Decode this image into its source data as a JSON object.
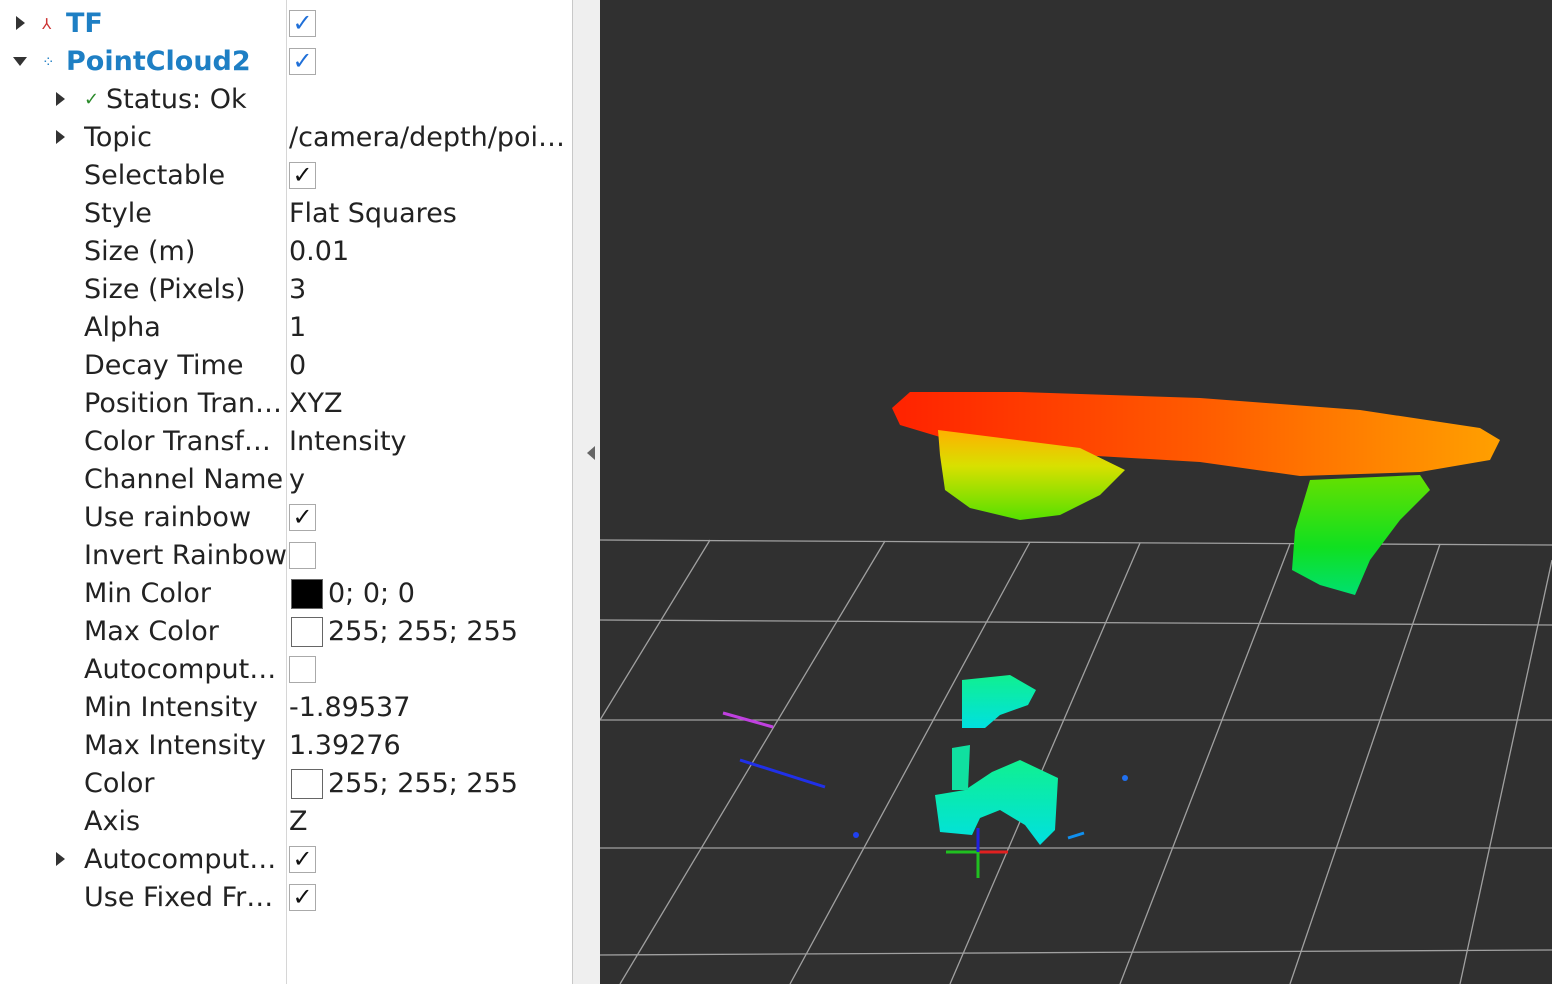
{
  "tree": {
    "tf": {
      "label": "TF",
      "checked": "✓",
      "icon": "tf-axes-icon"
    },
    "pointcloud": {
      "label": "PointCloud2",
      "checked": "✓",
      "icon": "pointcloud-icon"
    },
    "props": {
      "status_label": "Status: Ok",
      "status_icon": "check-icon",
      "status_check_glyph": "✓",
      "topic_label": "Topic",
      "topic_value": "/camera/depth/poi…",
      "selectable_label": "Selectable",
      "selectable_check": "✓",
      "style_label": "Style",
      "style_value": "Flat Squares",
      "size_m_label": "Size (m)",
      "size_m_value": "0.01",
      "size_px_label": "Size (Pixels)",
      "size_px_value": "3",
      "alpha_label": "Alpha",
      "alpha_value": "1",
      "decay_label": "Decay Time",
      "decay_value": "0",
      "pos_tf_label": "Position Tran…",
      "pos_tf_value": "XYZ",
      "color_tf_label": "Color Transf…",
      "color_tf_value": "Intensity",
      "channel_label": "Channel Name",
      "channel_value": "y",
      "rainbow_label": "Use rainbow",
      "rainbow_check": "✓",
      "invert_label": "Invert Rainbow",
      "min_color_label": "Min Color",
      "min_color_value": "0; 0; 0",
      "min_color_hex": "#000000",
      "max_color_label": "Max Color",
      "max_color_value": "255; 255; 255",
      "max_color_hex": "#ffffff",
      "autocompute1_label": "Autocomput…",
      "min_int_label": "Min Intensity",
      "min_int_value": "-1.89537",
      "max_int_label": "Max Intensity",
      "max_int_value": "1.39276",
      "color_label": "Color",
      "color_value": "255; 255; 255",
      "color_hex": "#ffffff",
      "axis_label": "Axis",
      "axis_value": "Z",
      "autocompute2_label": "Autocomput…",
      "autocompute2_check": "✓",
      "fixed_frame_label": "Use Fixed Fr…",
      "fixed_frame_check": "✓"
    }
  },
  "viewport": {
    "background": "#303030",
    "grid_color": "#a0a0a0"
  }
}
